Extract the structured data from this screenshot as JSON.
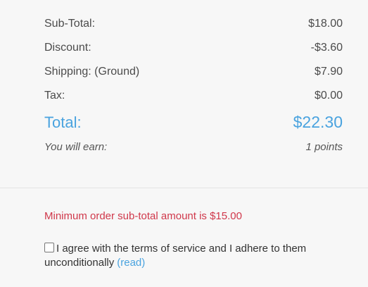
{
  "summary": {
    "subtotal": {
      "label": "Sub-Total:",
      "value": "$18.00"
    },
    "discount": {
      "label": "Discount:",
      "value": "-$3.60"
    },
    "shipping": {
      "label": "Shipping: (Ground)",
      "value": "$7.90"
    },
    "tax": {
      "label": "Tax:",
      "value": "$0.00"
    },
    "total": {
      "label": "Total:",
      "value": "$22.30"
    },
    "earn": {
      "label": "You will earn:",
      "value": "1 points"
    }
  },
  "messages": {
    "minimum": "Minimum order sub-total amount is $15.00"
  },
  "terms": {
    "text": "I agree with the terms of service and I adhere to them unconditionally",
    "link": "(read)"
  },
  "colors": {
    "accent": "#4aa3df",
    "error": "#d0384b"
  }
}
